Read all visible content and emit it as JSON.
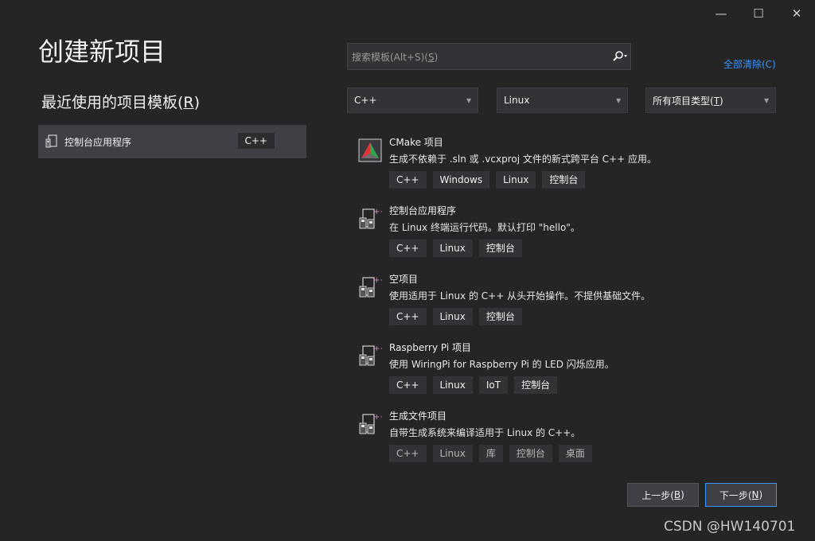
{
  "window": {
    "minimize_glyph": "—",
    "maximize_glyph": "☐",
    "close_glyph": "✕"
  },
  "page_title": "创建新项目",
  "recent": {
    "title_prefix": "最近使用的项目模板(",
    "title_key": "R",
    "title_suffix": ")",
    "items": [
      {
        "label": "控制台应用程序",
        "lang": "C++",
        "icon": "console-app-icon"
      }
    ]
  },
  "search": {
    "placeholder_prefix": "搜索模板(Alt+S)(",
    "placeholder_key": "S",
    "placeholder_suffix": ")",
    "icon": "search-icon"
  },
  "clear_all": "全部清除(C)",
  "filters": {
    "language": "C++",
    "platform": "Linux",
    "project_type_prefix": "所有项目类型(",
    "project_type_key": "T",
    "project_type_suffix": ")"
  },
  "templates": [
    {
      "name": "CMake 项目",
      "description": "生成不依赖于 .sln 或 .vcxproj 文件的新式跨平台 C++ 应用。",
      "tags": [
        "C++",
        "Windows",
        "Linux",
        "控制台"
      ],
      "icon": "cmake-icon"
    },
    {
      "name": "控制台应用程序",
      "description": "在 Linux 终端运行代码。默认打印 \"hello\"。",
      "tags": [
        "C++",
        "Linux",
        "控制台"
      ],
      "icon": "linux-console-icon"
    },
    {
      "name": "空项目",
      "description": "使用适用于 Linux 的 C++ 从头开始操作。不提供基础文件。",
      "tags": [
        "C++",
        "Linux",
        "控制台"
      ],
      "icon": "linux-console-icon"
    },
    {
      "name": "Raspberry Pi 项目",
      "description": "使用 WiringPi for Raspberry Pi 的 LED 闪烁应用。",
      "tags": [
        "C++",
        "Linux",
        "IoT",
        "控制台"
      ],
      "icon": "linux-console-icon"
    },
    {
      "name": "生成文件项目",
      "description": "自带生成系统来编译适用于 Linux 的 C++。",
      "tags": [
        "C++",
        "Linux",
        "库",
        "控制台",
        "桌面"
      ],
      "icon": "linux-console-icon"
    }
  ],
  "buttons": {
    "back_prefix": "上一步(",
    "back_key": "B",
    "back_suffix": ")",
    "next_prefix": "下一步(",
    "next_key": "N",
    "next_suffix": ")"
  },
  "watermark": "CSDN @HW140701",
  "colors": {
    "background": "#252526",
    "accent_link": "#3794ff",
    "selected_item": "#3f3f46"
  }
}
